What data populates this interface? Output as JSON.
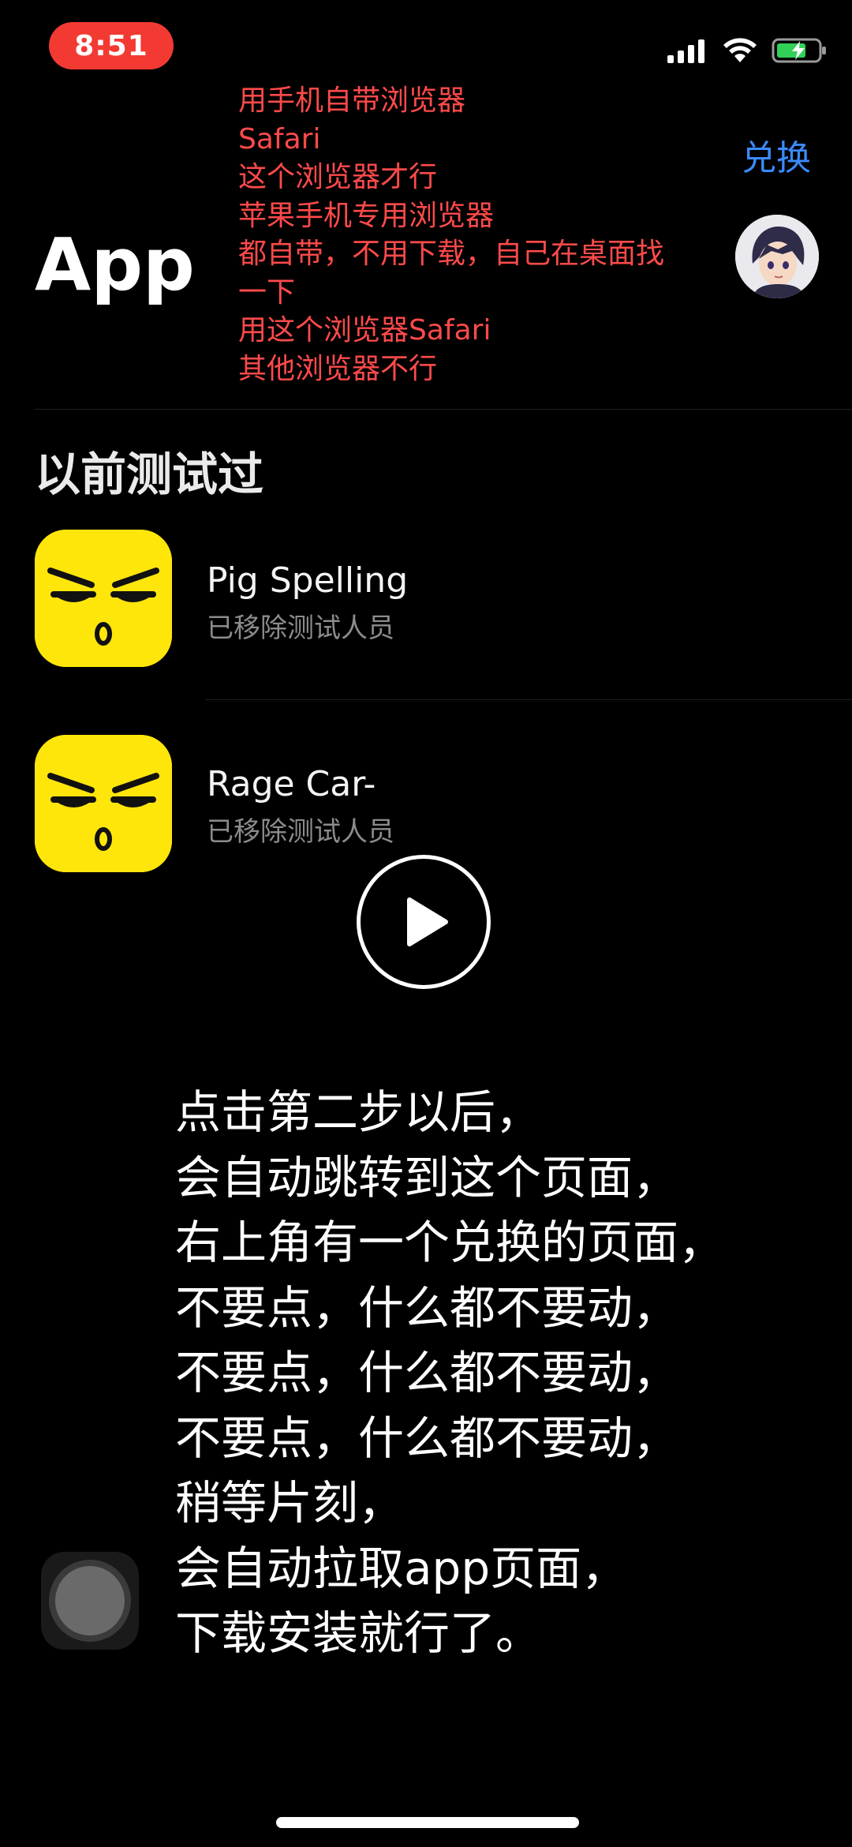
{
  "status_bar": {
    "time": "8:51",
    "signal_icon": "cellular-signal-icon",
    "wifi_icon": "wifi-icon",
    "battery_icon": "battery-charging-icon",
    "colors": {
      "time_pill": "#f23a33",
      "battery": "#31d158"
    }
  },
  "header": {
    "title": "App",
    "redeem_label": "兑换",
    "avatar_icon": "user-avatar-icon"
  },
  "note": {
    "lines": [
      "用手机自带浏览器",
      "Safari",
      "这个浏览器才行",
      "苹果手机专用浏览器",
      "都自带，不用下载，自己在桌面找",
      "一下",
      "用这个浏览器Safari",
      "其他浏览器不行"
    ],
    "color": "#ff4a4a"
  },
  "section": {
    "title": "以前测试过"
  },
  "apps": [
    {
      "name": "Pig Spelling",
      "status": "已移除测试人员",
      "icon": "yellow-face-app-icon"
    },
    {
      "name": "Rage Car-",
      "status": "已移除测试人员",
      "icon": "yellow-face-app-icon"
    }
  ],
  "video": {
    "play_icon": "play-icon"
  },
  "overlay": {
    "lines": [
      "点击第二步以后，",
      "会自动跳转到这个页面，",
      "右上角有一个兑换的页面，",
      "不要点，什么都不要动，",
      "不要点，什么都不要动，",
      "不要点，什么都不要动，",
      "稍等片刻，",
      "会自动拉取app页面，",
      "下载安装就行了。"
    ]
  },
  "assistive_touch_icon": "assistive-touch-icon",
  "accent_color": "#3b8bff"
}
